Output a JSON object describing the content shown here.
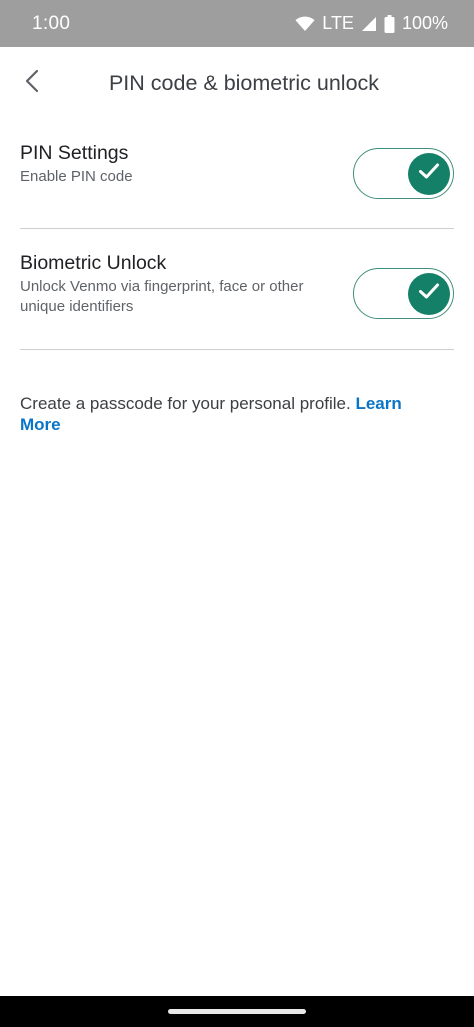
{
  "status_bar": {
    "time": "1:00",
    "network": "LTE",
    "battery": "100%"
  },
  "header": {
    "title": "PIN code & biometric unlock",
    "back_icon": "chevron-left-icon"
  },
  "settings": [
    {
      "title": "PIN Settings",
      "subtitle": "Enable PIN code",
      "enabled": true
    },
    {
      "title": "Biometric Unlock",
      "subtitle": "Unlock Venmo via fingerprint, face or other unique identifiers",
      "enabled": true
    }
  ],
  "info": {
    "text": "Create a passcode for your personal profile. ",
    "link_label": "Learn More"
  },
  "colors": {
    "accent": "#148067",
    "link": "#0a74c7",
    "status_bar": "#9e9e9e"
  }
}
